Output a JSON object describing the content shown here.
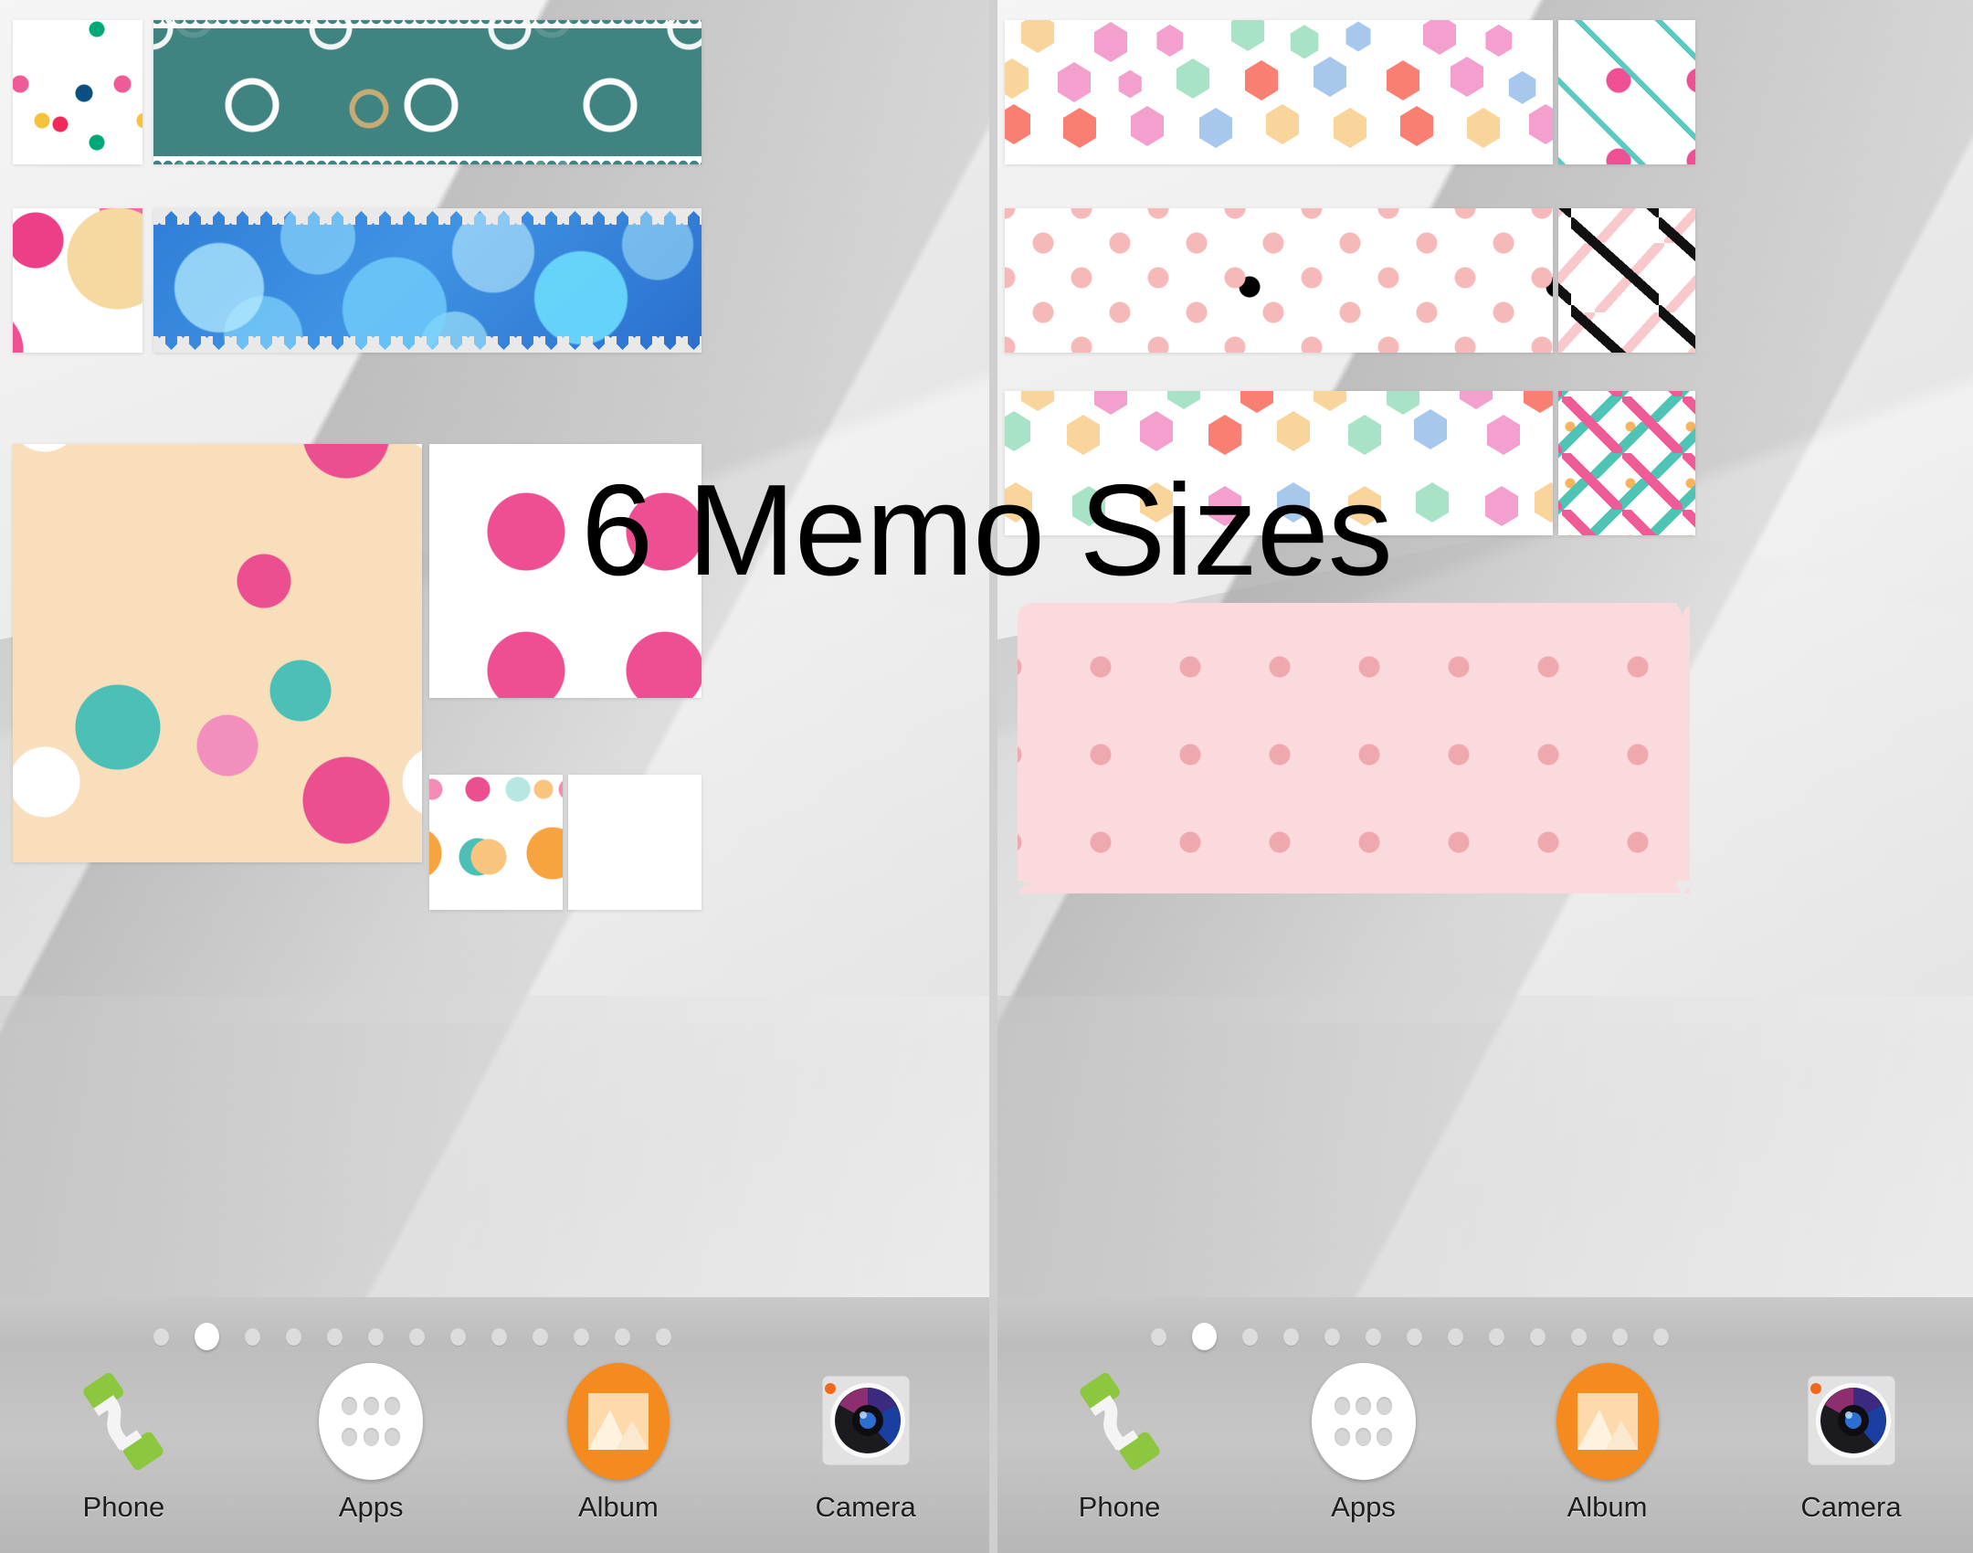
{
  "title": "6 Memo Sizes",
  "panels": [
    {
      "name": "left-home-screen",
      "page_dots": {
        "count": 13,
        "active_index": 1
      },
      "memos": [
        {
          "id": "confetti-dots-small",
          "pattern": "confetti-dots",
          "edge": "straight"
        },
        {
          "id": "teal-rings-wide",
          "pattern": "teal-rings",
          "edge": "torn"
        },
        {
          "id": "pink-bubbles-small",
          "pattern": "pink-bubbles",
          "edge": "straight"
        },
        {
          "id": "blue-bokeh-wide",
          "pattern": "blue-bokeh",
          "edge": "zigzag"
        },
        {
          "id": "beige-dots-large",
          "pattern": "beige-dots",
          "edge": "straight"
        },
        {
          "id": "white-pinkdots-medium",
          "pattern": "white-pink-dots",
          "edge": "straight"
        },
        {
          "id": "multi-dots-tiny",
          "pattern": "multi-dots",
          "edge": "straight"
        },
        {
          "id": "black-dot-tiny",
          "pattern": "black-dot",
          "edge": "straight"
        }
      ]
    },
    {
      "name": "right-home-screen",
      "page_dots": {
        "count": 13,
        "active_index": 1
      },
      "memos": [
        {
          "id": "hex-wide-1",
          "pattern": "hexagons",
          "edge": "straight"
        },
        {
          "id": "diag-lines-small",
          "pattern": "diagonal-lines",
          "edge": "straight"
        },
        {
          "id": "pink-black-dots",
          "pattern": "pink-black-dots",
          "edge": "straight"
        },
        {
          "id": "confetti-sticks",
          "pattern": "confetti-sticks",
          "edge": "straight"
        },
        {
          "id": "hex-wide-2",
          "pattern": "hexagons",
          "edge": "straight"
        },
        {
          "id": "confetti-dash",
          "pattern": "confetti-dash",
          "edge": "straight"
        },
        {
          "id": "pink-scallop-wide",
          "pattern": "pink-scallop",
          "edge": "scallop"
        }
      ]
    }
  ],
  "dock": {
    "items": [
      {
        "label": "Phone",
        "icon": "phone-handset-icon"
      },
      {
        "label": "Apps",
        "icon": "app-drawer-icon"
      },
      {
        "label": "Album",
        "icon": "photo-album-icon"
      },
      {
        "label": "Camera",
        "icon": "camera-icon"
      }
    ]
  },
  "colors": {
    "teal_memo": "#3F8480",
    "blue_memo": "#3A86DC",
    "beige_memo": "#F9DEBB",
    "pink_memo": "#FBDADE",
    "accent_pink": "#EC4F90",
    "accent_teal": "#4CC0B6",
    "album_orange": "#F58A1F",
    "phone_green": "#8DC63F"
  }
}
